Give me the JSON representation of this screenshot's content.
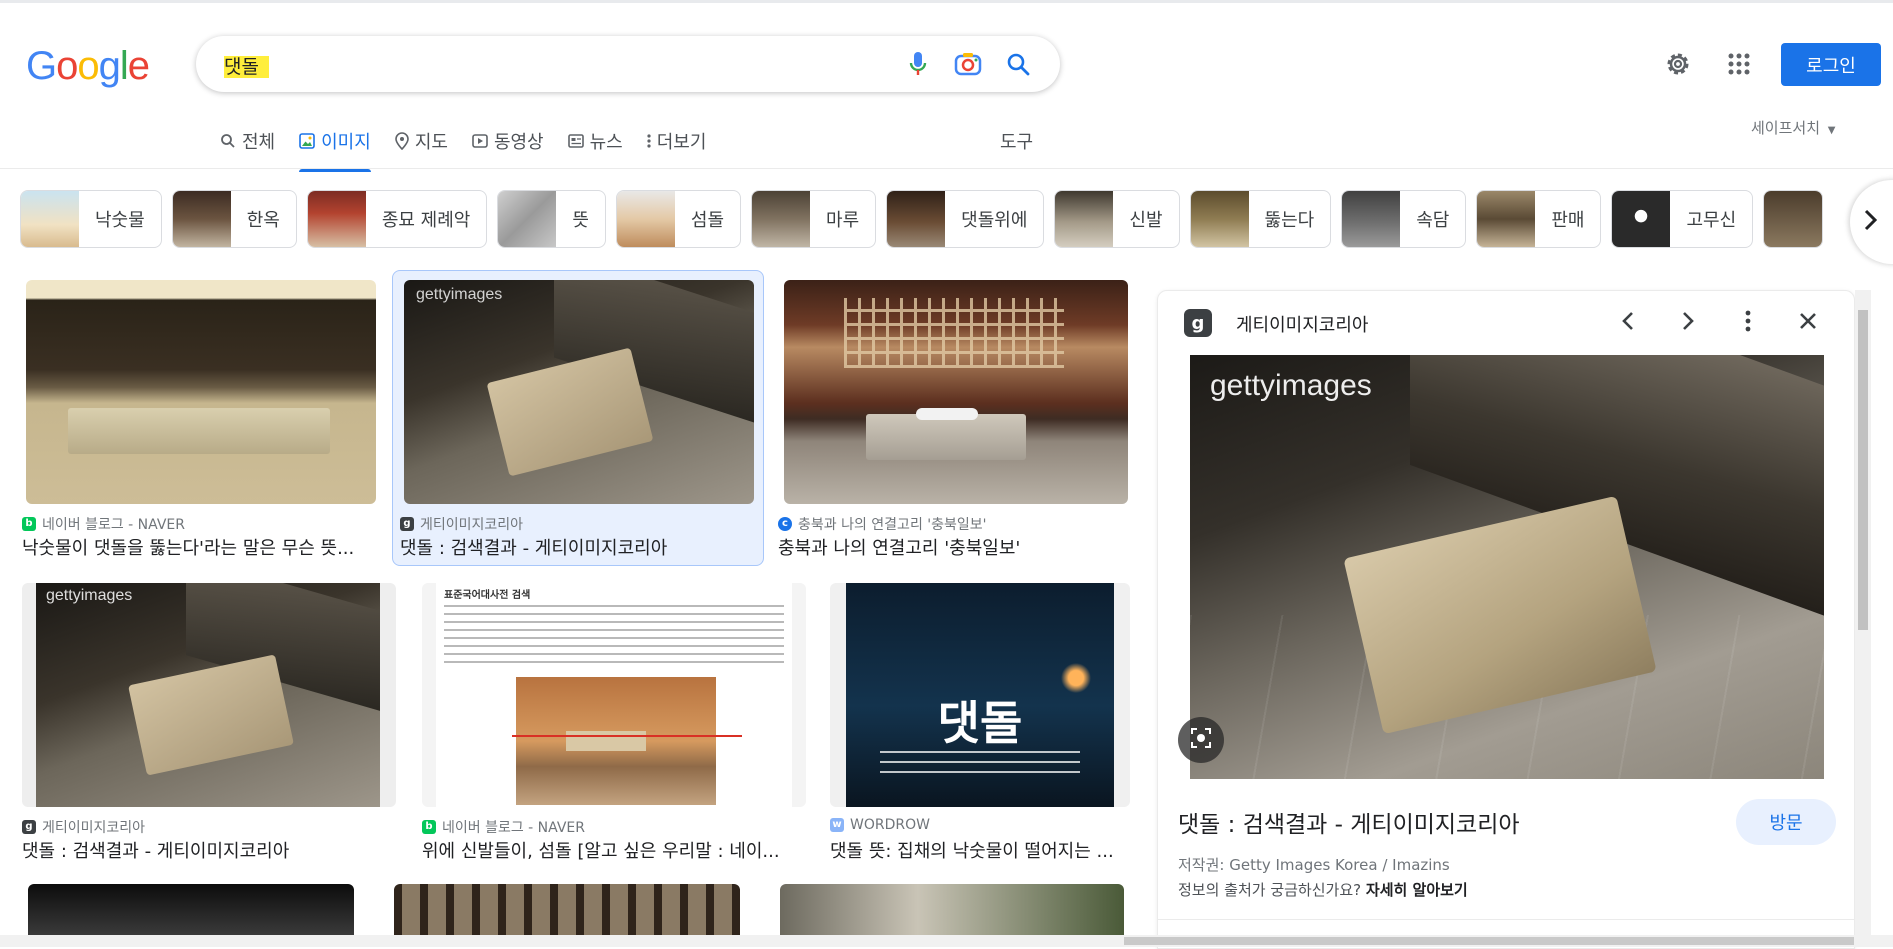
{
  "search": {
    "query": "댓돌"
  },
  "header": {
    "logo_letters": [
      "G",
      "o",
      "o",
      "g",
      "l",
      "e"
    ],
    "logo_colors": [
      "#4285f4",
      "#ea4335",
      "#fbbc05",
      "#4285f4",
      "#34a853",
      "#ea4335"
    ],
    "login_label": "로그인",
    "icons": [
      "mic-icon",
      "camera-icon",
      "search-icon",
      "gear-icon",
      "apps-icon"
    ]
  },
  "tabs": [
    {
      "label": "전체",
      "icon": "search-icon"
    },
    {
      "label": "이미지",
      "icon": "image-icon",
      "active": true
    },
    {
      "label": "지도",
      "icon": "pin-icon"
    },
    {
      "label": "동영상",
      "icon": "play-icon"
    },
    {
      "label": "뉴스",
      "icon": "news-icon"
    },
    {
      "label": "더보기",
      "icon": "more-vert-icon"
    }
  ],
  "tools_label": "도구",
  "safesearch_label": "세이프서치",
  "chips": [
    {
      "label": "낙숫물"
    },
    {
      "label": "한옥"
    },
    {
      "label": "종묘 제례악"
    },
    {
      "label": "뜻"
    },
    {
      "label": "섬돌"
    },
    {
      "label": "마루"
    },
    {
      "label": "댓돌위에"
    },
    {
      "label": "신발"
    },
    {
      "label": "뚫는다"
    },
    {
      "label": "속담"
    },
    {
      "label": "판매"
    },
    {
      "label": "고무신"
    }
  ],
  "results": [
    {
      "source": "네이버 블로그 - NAVER",
      "title": "낙숫물이 댓돌을 뚫는다'라는 말은 무슨 뜻..."
    },
    {
      "source": "게티이미지코리아",
      "title": "댓돌 : 검색결과 - 게티이미지코리아",
      "overlay": "gettyimages"
    },
    {
      "source": "충북과 나의 연결고리 '충북일보'",
      "title": "충북과 나의 연결고리 '충북일보'"
    },
    {
      "source": "게티이미지코리아",
      "title": "댓돌 : 검색결과 - 게티이미지코리아",
      "overlay": "gettyimages"
    },
    {
      "source": "네이버 블로그 - NAVER",
      "title": "위에 신발들이, 섬돌 [알고 싶은 우리말 : 네이...",
      "doc_heading": "표준국어대사전 검색"
    },
    {
      "source": "WORDROW",
      "title": "댓돌 뜻: 집채의 낙숫물이 떨어지는 ...",
      "big_word": "댓돌"
    }
  ],
  "panel": {
    "source": "게티이미지코리아",
    "overlay": "gettyimages",
    "title": "댓돌 : 검색결과 - 게티이미지코리아",
    "visit_label": "방문",
    "copyright": "저작권: Getty Images Korea / Imazins",
    "more_text": "정보의 출처가 궁금하신가요?",
    "more_link": "자세히 알아보기"
  }
}
